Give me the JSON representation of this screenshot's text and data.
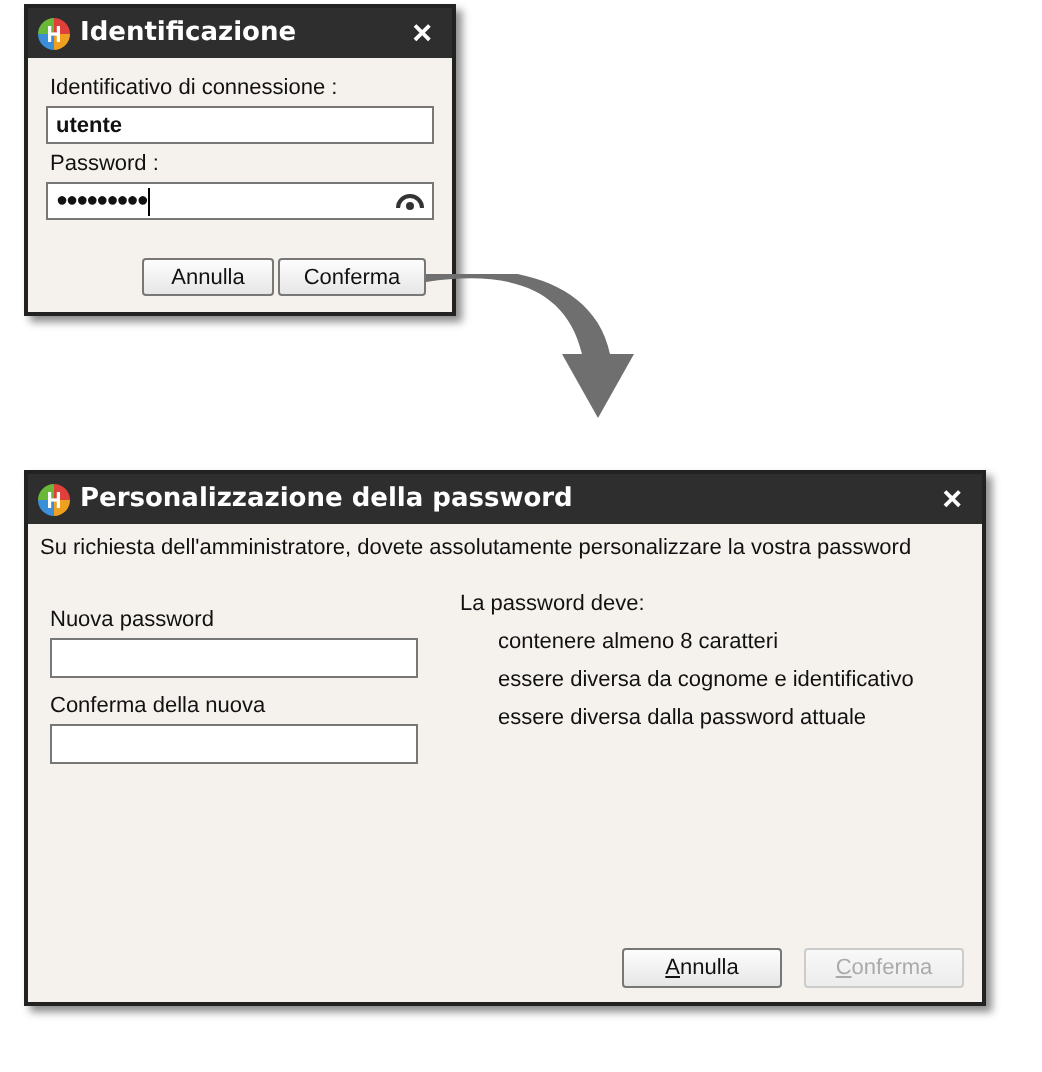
{
  "login_dialog": {
    "title": "Identificazione",
    "close": "×",
    "fields": [
      {
        "label": "Identificativo di connessione :",
        "value": "utente",
        "kind": "text"
      },
      {
        "label": "Password :",
        "value": "●●●●●●●●●",
        "kind": "password"
      }
    ],
    "buttons": [
      {
        "label": "Annulla",
        "disabled": false
      },
      {
        "label": "Conferma",
        "disabled": false
      }
    ]
  },
  "password_dialog": {
    "title": "Personalizzazione della password",
    "close": "×",
    "message": "Su richiesta dell'amministratore, dovete assolutamente personalizzare la vostra password",
    "fields": [
      {
        "label": "Nuova password"
      },
      {
        "label": "Conferma della nuova"
      }
    ],
    "rules_title": "La password deve:",
    "rules": [
      "contenere almeno 8 caratteri",
      "essere diversa da cognome e identificativo",
      "essere diversa dalla password attuale"
    ],
    "buttons": [
      {
        "label": "Annulla",
        "disabled": false
      },
      {
        "label": "Conferma",
        "disabled": true
      }
    ]
  }
}
